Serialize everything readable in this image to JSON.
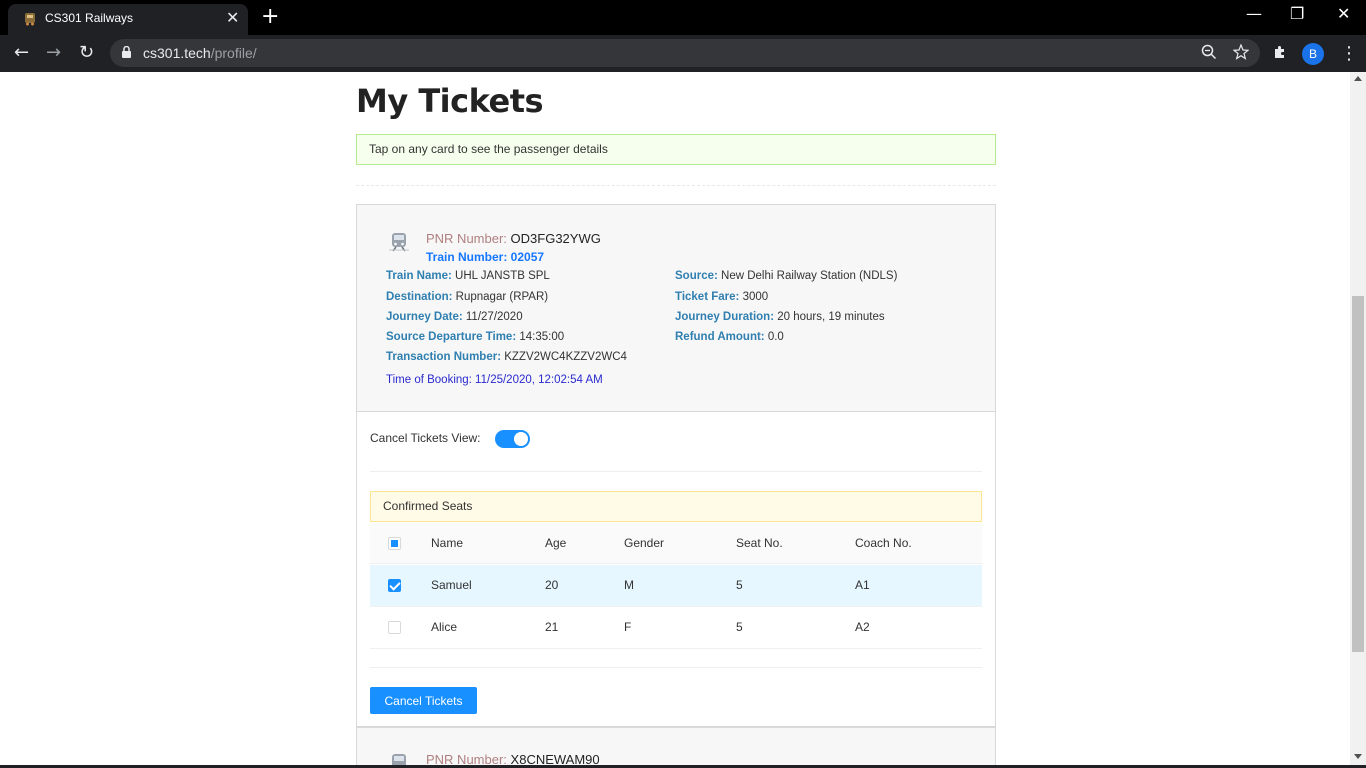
{
  "browser": {
    "tab_title": "CS301 Railways",
    "close_glyph": "✕",
    "new_tab_glyph": "+",
    "minimize_glyph": "—",
    "restore_glyph": "❐",
    "window_close_glyph": "✕",
    "back_glyph": "←",
    "forward_glyph": "→",
    "reload_glyph": "↻",
    "url_host": "cs301.tech",
    "url_path": "/profile/",
    "profile_initial": "B",
    "menu_glyph": "⋮"
  },
  "page": {
    "title": "My Tickets",
    "info_message": "Tap on any card to see the passenger details"
  },
  "ticket": {
    "pnr_label": "PNR Number:",
    "pnr_value": "OD3FG32YWG",
    "train_number": "Train Number: 02057",
    "fields_left": [
      {
        "label": "Train Name:",
        "value": "UHL JANSTB SPL"
      },
      {
        "label": "Destination:",
        "value": "Rupnagar (RPAR)"
      },
      {
        "label": "Journey Date:",
        "value": "11/27/2020"
      },
      {
        "label": "Source Departure Time:",
        "value": "14:35:00"
      },
      {
        "label": "Transaction Number:",
        "value": "KZZV2WC4KZZV2WC4"
      }
    ],
    "fields_right": [
      {
        "label": "Source:",
        "value": "New Delhi Railway Station (NDLS)"
      },
      {
        "label": "Ticket Fare:",
        "value": "3000"
      },
      {
        "label": "Journey Duration:",
        "value": "20 hours, 19 minutes"
      },
      {
        "label": "Refund Amount:",
        "value": "0.0"
      }
    ],
    "time_of_booking": "Time of Booking: 11/25/2020, 12:02:54 AM",
    "cancel_view_label": "Cancel Tickets View:",
    "cancel_view_on": true,
    "confirmed_seats_label": "Confirmed Seats",
    "columns": [
      "Name",
      "Age",
      "Gender",
      "Seat No.",
      "Coach No."
    ],
    "passengers": [
      {
        "name": "Samuel",
        "age": "20",
        "gender": "M",
        "seat": "5",
        "coach": "A1",
        "selected": true
      },
      {
        "name": "Alice",
        "age": "21",
        "gender": "F",
        "seat": "5",
        "coach": "A2",
        "selected": false
      }
    ],
    "cancel_button_label": "Cancel Tickets"
  },
  "next_ticket": {
    "pnr_label": "PNR Number:",
    "pnr_value": "X8CNEWAM90"
  },
  "colors": {
    "accent": "#1890ff",
    "label_blue": "#2f7fb0",
    "booking_text": "#2a2ad0"
  }
}
